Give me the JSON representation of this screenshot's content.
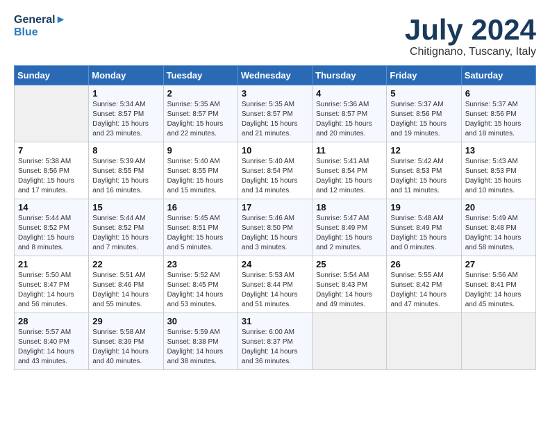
{
  "header": {
    "logo_line1": "General",
    "logo_line2": "Blue",
    "month": "July 2024",
    "location": "Chitignano, Tuscany, Italy"
  },
  "weekdays": [
    "Sunday",
    "Monday",
    "Tuesday",
    "Wednesday",
    "Thursday",
    "Friday",
    "Saturday"
  ],
  "weeks": [
    [
      {
        "day": "",
        "sunrise": "",
        "sunset": "",
        "daylight": ""
      },
      {
        "day": "1",
        "sunrise": "Sunrise: 5:34 AM",
        "sunset": "Sunset: 8:57 PM",
        "daylight": "Daylight: 15 hours and 23 minutes."
      },
      {
        "day": "2",
        "sunrise": "Sunrise: 5:35 AM",
        "sunset": "Sunset: 8:57 PM",
        "daylight": "Daylight: 15 hours and 22 minutes."
      },
      {
        "day": "3",
        "sunrise": "Sunrise: 5:35 AM",
        "sunset": "Sunset: 8:57 PM",
        "daylight": "Daylight: 15 hours and 21 minutes."
      },
      {
        "day": "4",
        "sunrise": "Sunrise: 5:36 AM",
        "sunset": "Sunset: 8:57 PM",
        "daylight": "Daylight: 15 hours and 20 minutes."
      },
      {
        "day": "5",
        "sunrise": "Sunrise: 5:37 AM",
        "sunset": "Sunset: 8:56 PM",
        "daylight": "Daylight: 15 hours and 19 minutes."
      },
      {
        "day": "6",
        "sunrise": "Sunrise: 5:37 AM",
        "sunset": "Sunset: 8:56 PM",
        "daylight": "Daylight: 15 hours and 18 minutes."
      }
    ],
    [
      {
        "day": "7",
        "sunrise": "Sunrise: 5:38 AM",
        "sunset": "Sunset: 8:56 PM",
        "daylight": "Daylight: 15 hours and 17 minutes."
      },
      {
        "day": "8",
        "sunrise": "Sunrise: 5:39 AM",
        "sunset": "Sunset: 8:55 PM",
        "daylight": "Daylight: 15 hours and 16 minutes."
      },
      {
        "day": "9",
        "sunrise": "Sunrise: 5:40 AM",
        "sunset": "Sunset: 8:55 PM",
        "daylight": "Daylight: 15 hours and 15 minutes."
      },
      {
        "day": "10",
        "sunrise": "Sunrise: 5:40 AM",
        "sunset": "Sunset: 8:54 PM",
        "daylight": "Daylight: 15 hours and 14 minutes."
      },
      {
        "day": "11",
        "sunrise": "Sunrise: 5:41 AM",
        "sunset": "Sunset: 8:54 PM",
        "daylight": "Daylight: 15 hours and 12 minutes."
      },
      {
        "day": "12",
        "sunrise": "Sunrise: 5:42 AM",
        "sunset": "Sunset: 8:53 PM",
        "daylight": "Daylight: 15 hours and 11 minutes."
      },
      {
        "day": "13",
        "sunrise": "Sunrise: 5:43 AM",
        "sunset": "Sunset: 8:53 PM",
        "daylight": "Daylight: 15 hours and 10 minutes."
      }
    ],
    [
      {
        "day": "14",
        "sunrise": "Sunrise: 5:44 AM",
        "sunset": "Sunset: 8:52 PM",
        "daylight": "Daylight: 15 hours and 8 minutes."
      },
      {
        "day": "15",
        "sunrise": "Sunrise: 5:44 AM",
        "sunset": "Sunset: 8:52 PM",
        "daylight": "Daylight: 15 hours and 7 minutes."
      },
      {
        "day": "16",
        "sunrise": "Sunrise: 5:45 AM",
        "sunset": "Sunset: 8:51 PM",
        "daylight": "Daylight: 15 hours and 5 minutes."
      },
      {
        "day": "17",
        "sunrise": "Sunrise: 5:46 AM",
        "sunset": "Sunset: 8:50 PM",
        "daylight": "Daylight: 15 hours and 3 minutes."
      },
      {
        "day": "18",
        "sunrise": "Sunrise: 5:47 AM",
        "sunset": "Sunset: 8:49 PM",
        "daylight": "Daylight: 15 hours and 2 minutes."
      },
      {
        "day": "19",
        "sunrise": "Sunrise: 5:48 AM",
        "sunset": "Sunset: 8:49 PM",
        "daylight": "Daylight: 15 hours and 0 minutes."
      },
      {
        "day": "20",
        "sunrise": "Sunrise: 5:49 AM",
        "sunset": "Sunset: 8:48 PM",
        "daylight": "Daylight: 14 hours and 58 minutes."
      }
    ],
    [
      {
        "day": "21",
        "sunrise": "Sunrise: 5:50 AM",
        "sunset": "Sunset: 8:47 PM",
        "daylight": "Daylight: 14 hours and 56 minutes."
      },
      {
        "day": "22",
        "sunrise": "Sunrise: 5:51 AM",
        "sunset": "Sunset: 8:46 PM",
        "daylight": "Daylight: 14 hours and 55 minutes."
      },
      {
        "day": "23",
        "sunrise": "Sunrise: 5:52 AM",
        "sunset": "Sunset: 8:45 PM",
        "daylight": "Daylight: 14 hours and 53 minutes."
      },
      {
        "day": "24",
        "sunrise": "Sunrise: 5:53 AM",
        "sunset": "Sunset: 8:44 PM",
        "daylight": "Daylight: 14 hours and 51 minutes."
      },
      {
        "day": "25",
        "sunrise": "Sunrise: 5:54 AM",
        "sunset": "Sunset: 8:43 PM",
        "daylight": "Daylight: 14 hours and 49 minutes."
      },
      {
        "day": "26",
        "sunrise": "Sunrise: 5:55 AM",
        "sunset": "Sunset: 8:42 PM",
        "daylight": "Daylight: 14 hours and 47 minutes."
      },
      {
        "day": "27",
        "sunrise": "Sunrise: 5:56 AM",
        "sunset": "Sunset: 8:41 PM",
        "daylight": "Daylight: 14 hours and 45 minutes."
      }
    ],
    [
      {
        "day": "28",
        "sunrise": "Sunrise: 5:57 AM",
        "sunset": "Sunset: 8:40 PM",
        "daylight": "Daylight: 14 hours and 43 minutes."
      },
      {
        "day": "29",
        "sunrise": "Sunrise: 5:58 AM",
        "sunset": "Sunset: 8:39 PM",
        "daylight": "Daylight: 14 hours and 40 minutes."
      },
      {
        "day": "30",
        "sunrise": "Sunrise: 5:59 AM",
        "sunset": "Sunset: 8:38 PM",
        "daylight": "Daylight: 14 hours and 38 minutes."
      },
      {
        "day": "31",
        "sunrise": "Sunrise: 6:00 AM",
        "sunset": "Sunset: 8:37 PM",
        "daylight": "Daylight: 14 hours and 36 minutes."
      },
      {
        "day": "",
        "sunrise": "",
        "sunset": "",
        "daylight": ""
      },
      {
        "day": "",
        "sunrise": "",
        "sunset": "",
        "daylight": ""
      },
      {
        "day": "",
        "sunrise": "",
        "sunset": "",
        "daylight": ""
      }
    ]
  ]
}
